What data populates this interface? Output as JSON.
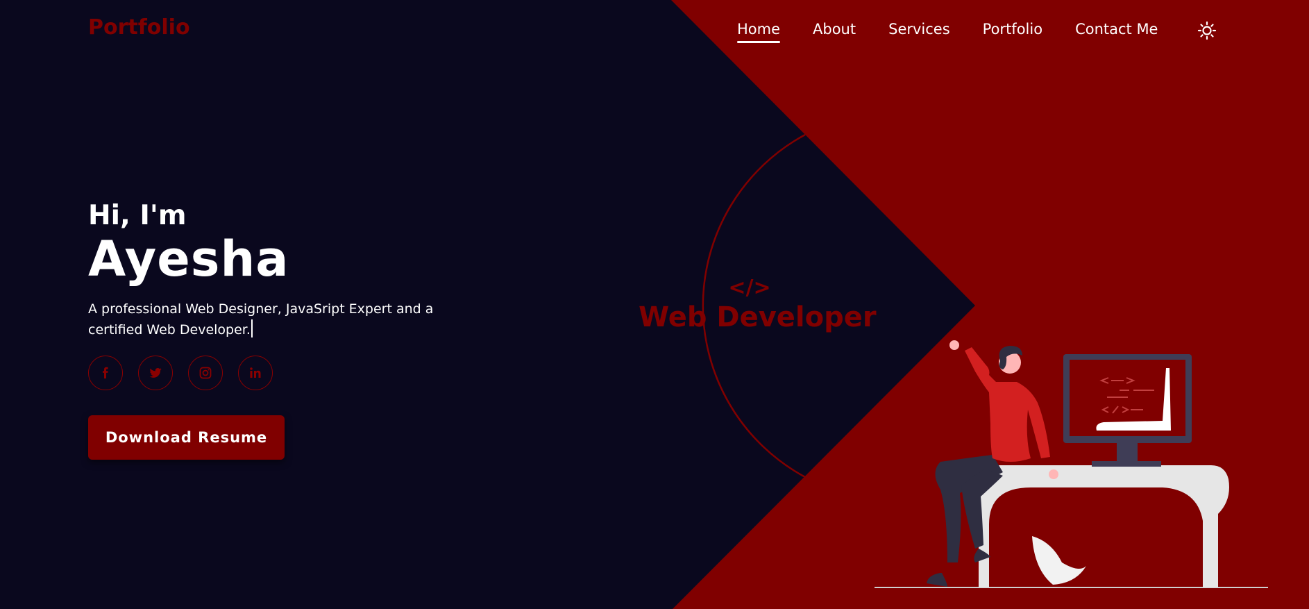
{
  "logo": "Portfolio",
  "nav": {
    "items": [
      "Home",
      "About",
      "Services",
      "Portfolio",
      "Contact Me"
    ],
    "active": "Home",
    "theme_icon": "sun-icon"
  },
  "hero": {
    "greeting": "Hi, I'm",
    "name": "Ayesha",
    "description": "A professional Web Designer, JavaSript Expert and a certified Web Developer.",
    "socials": [
      "facebook-icon",
      "twitter-icon",
      "instagram-icon",
      "linkedin-icon"
    ],
    "button": "Download Resume"
  },
  "center": {
    "code": "</>",
    "role": "Web Developer"
  },
  "colors": {
    "background": "#0a081e",
    "accent": "#800000",
    "text": "#ffffff"
  }
}
